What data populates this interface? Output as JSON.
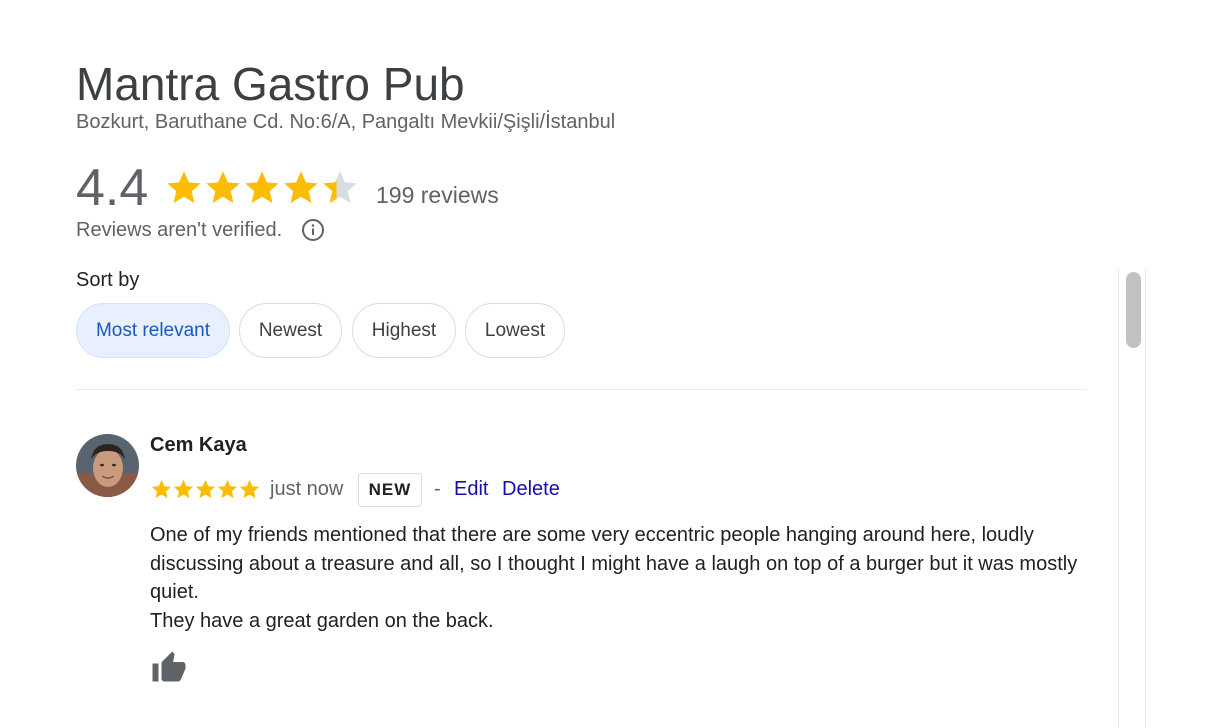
{
  "place": {
    "name": "Mantra Gastro Pub",
    "address": "Bozkurt, Baruthane Cd. No:6/A, Pangaltı Mevkii/Şişli/İstanbul"
  },
  "rating": {
    "value": "4.4",
    "stars": 4.4,
    "review_count_label": "199 reviews",
    "verified_note": "Reviews aren't verified."
  },
  "sort": {
    "label": "Sort by",
    "options": [
      "Most relevant",
      "Newest",
      "Highest",
      "Lowest"
    ],
    "selected": "Most relevant"
  },
  "review": {
    "author": "Cem Kaya",
    "stars": 5,
    "time": "just now",
    "badge": "NEW",
    "separator": "-",
    "edit_label": "Edit",
    "delete_label": "Delete",
    "paragraphs": [
      "One of my friends mentioned that there are some very eccentric people hanging around here, loudly discussing about a treasure and all, so I thought I might have a laugh on top of a burger but it was mostly quiet.",
      "They have a great garden on the back."
    ]
  },
  "colors": {
    "star": "#fbbc04",
    "star_empty": "#dadce0",
    "link": "#1a0dab",
    "chip_active_bg": "#e8f0fe",
    "chip_active_text": "#1a57c0"
  },
  "icons": [
    "star-icon",
    "info-icon",
    "avatar",
    "thumbs-up-icon"
  ]
}
